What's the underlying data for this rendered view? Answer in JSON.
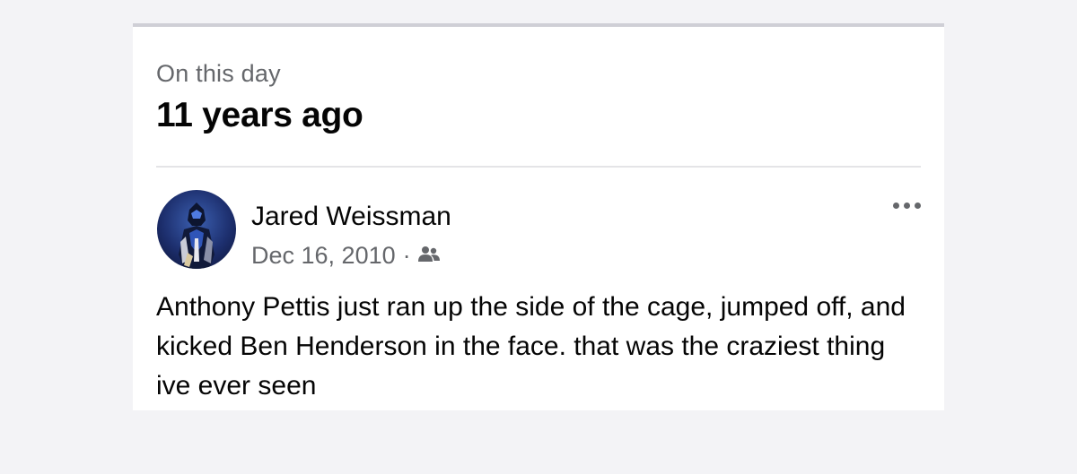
{
  "memory": {
    "eyebrow": "On this day",
    "title": "11 years ago"
  },
  "post": {
    "author": "Jared Weissman",
    "date": "Dec 16, 2010",
    "separator": "·",
    "audience_icon": "friends-icon",
    "more_icon": "more-options-icon",
    "avatar_icon": "profile-avatar",
    "text": "Anthony Pettis just ran up the side of the cage, jumped off, and kicked Ben Henderson in the face. that was the craziest thing ive ever seen"
  },
  "colors": {
    "primary_text": "#050505",
    "secondary_text": "#65676b",
    "background": "#f3f3f6",
    "card": "#ffffff"
  }
}
